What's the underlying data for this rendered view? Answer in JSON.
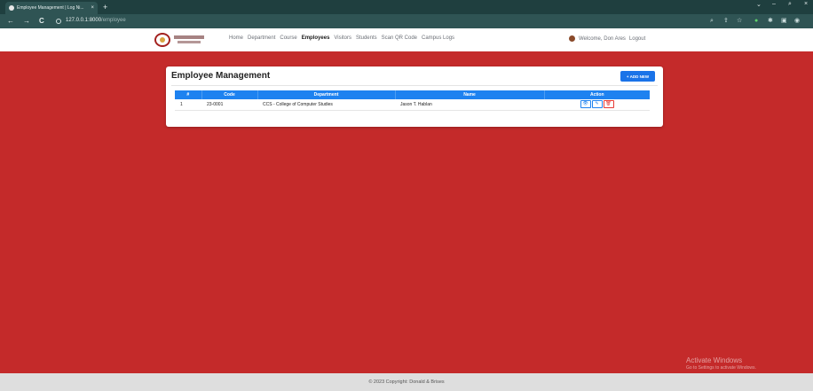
{
  "browser": {
    "tab_title": "Employee Management | Log Ni...",
    "tab_close": "×",
    "new_tab": "+",
    "back": "←",
    "forward": "→",
    "reload": "C",
    "url_host": "127.0.0.1:8000",
    "url_path": "/employee",
    "minimize": "⌄",
    "restore": "–",
    "maximize": "⌕",
    "close": "×"
  },
  "nav": {
    "links": [
      "Home",
      "Department",
      "Course",
      "Employees",
      "Visitors",
      "Students",
      "Scan QR Code",
      "Campus Logs"
    ],
    "active": "Employees",
    "welcome": "Welcome, Don Ares",
    "logout": "Logout"
  },
  "page": {
    "title": "Employee Management",
    "add_button": "+ ADD NEW"
  },
  "table": {
    "headers": [
      "#",
      "Code",
      "Department",
      "Name",
      "Action"
    ],
    "rows": [
      {
        "num": "1",
        "code": "23-0001",
        "department": "CCS - College of Computer Studies",
        "name": "Jason T. Hablan"
      }
    ],
    "actions": {
      "view": "👁",
      "edit": "✎",
      "delete": "🗑"
    }
  },
  "footer": {
    "text": "© 2023 Copyright: Donald & Brises"
  },
  "watermark": {
    "line1": "Activate Windows",
    "line2": "Go to Settings to activate Windows."
  },
  "colors": {
    "accent": "#1e82f0",
    "background": "#c42a2a",
    "danger": "#e53935"
  }
}
